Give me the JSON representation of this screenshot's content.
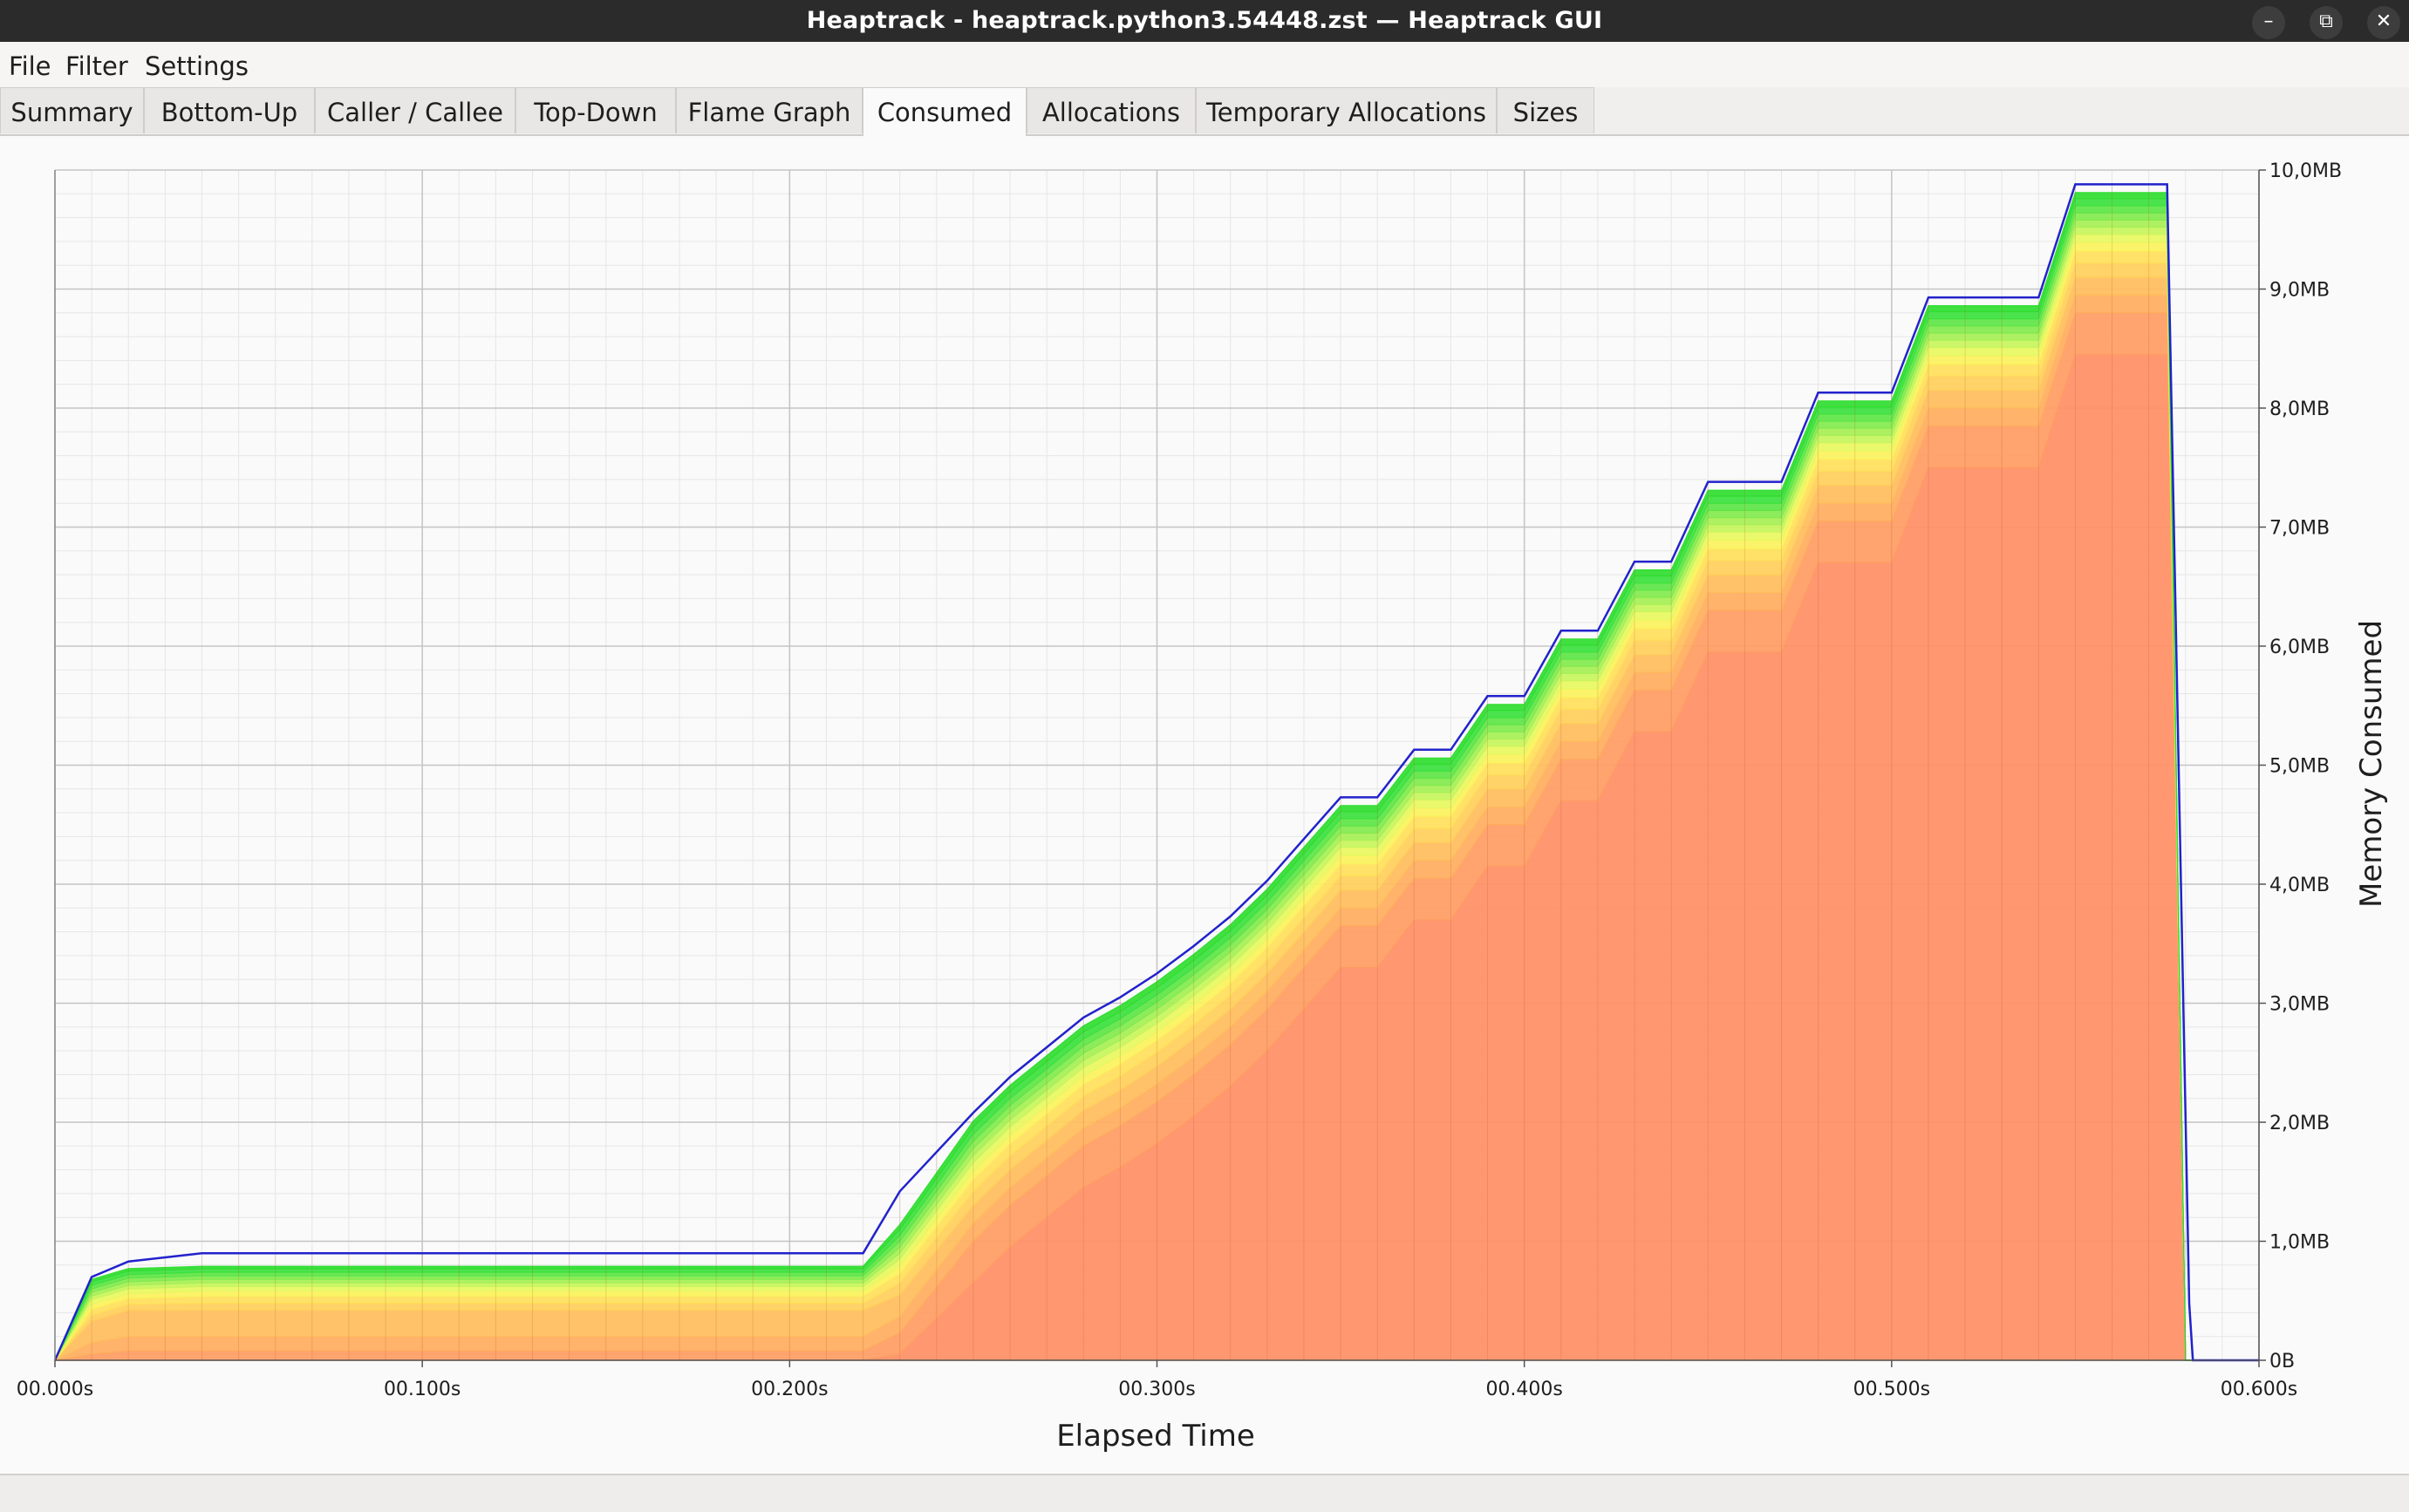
{
  "window": {
    "title": "Heaptrack - heaptrack.python3.54448.zst — Heaptrack GUI",
    "minimize_icon": "minimize-icon",
    "maximize_icon": "restore-icon",
    "close_icon": "close-icon"
  },
  "menubar": {
    "items": [
      {
        "label": "File"
      },
      {
        "label": "Filter"
      },
      {
        "label": "Settings"
      }
    ]
  },
  "tabs": [
    {
      "label": "Summary"
    },
    {
      "label": "Bottom-Up"
    },
    {
      "label": "Caller / Callee"
    },
    {
      "label": "Top-Down"
    },
    {
      "label": "Flame Graph"
    },
    {
      "label": "Consumed",
      "active": true
    },
    {
      "label": "Allocations"
    },
    {
      "label": "Temporary Allocations"
    },
    {
      "label": "Sizes"
    }
  ],
  "colors": {
    "line": "#2222cc",
    "bottom_layer": "#ff8f64",
    "top_layer": "#30dd30"
  },
  "chart_data": {
    "type": "area",
    "stacked": true,
    "xlabel": "Elapsed Time",
    "ylabel": "Memory Consumed",
    "xlim": [
      0,
      0.6
    ],
    "ylim": [
      0,
      10
    ],
    "x_ticks": [
      "00.000s",
      "00.100s",
      "00.200s",
      "00.300s",
      "00.400s",
      "00.500s",
      "00.600s"
    ],
    "y_ticks": [
      "0B",
      "1,0MB",
      "2,0MB",
      "3,0MB",
      "4,0MB",
      "5,0MB",
      "6,0MB",
      "7,0MB",
      "8,0MB",
      "9,0MB",
      "10,0MB"
    ],
    "grid": true,
    "y_axis_side": "right",
    "layer_colors": [
      "#ff8f64",
      "#ff9c62",
      "#ffac5e",
      "#ffbd5c",
      "#ffcf5a",
      "#ffe05a",
      "#fbf25c",
      "#e8f760",
      "#c8f55c",
      "#a6f056",
      "#82ea4e",
      "#5ee546",
      "#3ce13e",
      "#30dd30"
    ],
    "x": [
      0.0,
      0.01,
      0.02,
      0.04,
      0.1,
      0.2,
      0.22,
      0.23,
      0.25,
      0.26,
      0.27,
      0.28,
      0.29,
      0.3,
      0.31,
      0.32,
      0.33,
      0.34,
      0.35,
      0.36,
      0.37,
      0.38,
      0.39,
      0.4,
      0.41,
      0.42,
      0.43,
      0.44,
      0.45,
      0.46,
      0.47,
      0.48,
      0.49,
      0.5,
      0.51,
      0.52,
      0.53,
      0.54,
      0.55,
      0.56,
      0.575,
      0.58,
      0.582
    ],
    "series": [
      {
        "values": [
          0.0,
          0.0,
          0.0,
          0.0,
          0.0,
          0.0,
          0.0,
          0.05,
          0.65,
          0.95,
          1.2,
          1.45,
          1.62,
          1.82,
          2.05,
          2.3,
          2.6,
          2.95,
          3.3,
          3.3,
          3.7,
          3.7,
          4.15,
          4.15,
          4.7,
          4.7,
          5.28,
          5.28,
          5.95,
          5.95,
          5.95,
          6.7,
          6.7,
          6.7,
          7.5,
          7.5,
          7.5,
          7.5,
          8.45,
          8.45,
          8.45,
          0.0,
          0.0
        ]
      },
      {
        "values": [
          0.0,
          0.05,
          0.08,
          0.08,
          0.08,
          0.08,
          0.08,
          0.18,
          0.35,
          0.35,
          0.35,
          0.35,
          0.35,
          0.35,
          0.35,
          0.35,
          0.35,
          0.35,
          0.35,
          0.35,
          0.35,
          0.35,
          0.35,
          0.35,
          0.35,
          0.35,
          0.35,
          0.35,
          0.35,
          0.35,
          0.35,
          0.35,
          0.35,
          0.35,
          0.35,
          0.35,
          0.35,
          0.35,
          0.35,
          0.35,
          0.35,
          0.0,
          0.0
        ]
      },
      {
        "values": [
          0.0,
          0.1,
          0.12,
          0.12,
          0.12,
          0.12,
          0.12,
          0.14,
          0.15,
          0.15,
          0.15,
          0.15,
          0.15,
          0.15,
          0.15,
          0.15,
          0.15,
          0.15,
          0.15,
          0.15,
          0.15,
          0.15,
          0.15,
          0.15,
          0.15,
          0.15,
          0.15,
          0.15,
          0.15,
          0.15,
          0.15,
          0.15,
          0.15,
          0.15,
          0.15,
          0.15,
          0.15,
          0.15,
          0.15,
          0.15,
          0.15,
          0.0,
          0.0
        ]
      },
      {
        "values": [
          0.0,
          0.18,
          0.22,
          0.22,
          0.22,
          0.22,
          0.22,
          0.18,
          0.15,
          0.15,
          0.15,
          0.15,
          0.15,
          0.15,
          0.15,
          0.15,
          0.15,
          0.15,
          0.15,
          0.15,
          0.15,
          0.15,
          0.15,
          0.15,
          0.15,
          0.15,
          0.15,
          0.15,
          0.15,
          0.15,
          0.15,
          0.15,
          0.15,
          0.15,
          0.15,
          0.15,
          0.15,
          0.15,
          0.15,
          0.15,
          0.15,
          0.0,
          0.0
        ]
      },
      {
        "values": [
          0.0,
          0.05,
          0.05,
          0.06,
          0.06,
          0.06,
          0.06,
          0.1,
          0.12,
          0.12,
          0.12,
          0.12,
          0.12,
          0.12,
          0.12,
          0.12,
          0.12,
          0.12,
          0.12,
          0.12,
          0.12,
          0.12,
          0.12,
          0.12,
          0.12,
          0.12,
          0.12,
          0.12,
          0.12,
          0.12,
          0.12,
          0.12,
          0.12,
          0.12,
          0.12,
          0.12,
          0.12,
          0.12,
          0.12,
          0.12,
          0.12,
          0.0,
          0.0
        ]
      },
      {
        "values": [
          0.0,
          0.05,
          0.05,
          0.06,
          0.06,
          0.06,
          0.06,
          0.08,
          0.1,
          0.1,
          0.1,
          0.1,
          0.1,
          0.1,
          0.1,
          0.1,
          0.1,
          0.1,
          0.1,
          0.1,
          0.1,
          0.1,
          0.1,
          0.1,
          0.1,
          0.1,
          0.1,
          0.1,
          0.1,
          0.1,
          0.1,
          0.1,
          0.1,
          0.1,
          0.1,
          0.1,
          0.1,
          0.1,
          0.1,
          0.1,
          0.1,
          0.0,
          0.0
        ]
      },
      {
        "values": [
          0.0,
          0.04,
          0.04,
          0.04,
          0.04,
          0.04,
          0.04,
          0.06,
          0.07,
          0.07,
          0.07,
          0.07,
          0.07,
          0.07,
          0.07,
          0.07,
          0.07,
          0.07,
          0.07,
          0.07,
          0.07,
          0.07,
          0.07,
          0.07,
          0.07,
          0.07,
          0.07,
          0.07,
          0.07,
          0.07,
          0.07,
          0.07,
          0.07,
          0.07,
          0.07,
          0.07,
          0.07,
          0.07,
          0.07,
          0.07,
          0.07,
          0.0,
          0.0
        ]
      },
      {
        "values": [
          0.0,
          0.04,
          0.04,
          0.04,
          0.04,
          0.04,
          0.04,
          0.06,
          0.07,
          0.07,
          0.07,
          0.07,
          0.07,
          0.07,
          0.07,
          0.07,
          0.07,
          0.07,
          0.07,
          0.07,
          0.07,
          0.07,
          0.07,
          0.07,
          0.07,
          0.07,
          0.07,
          0.07,
          0.07,
          0.07,
          0.07,
          0.07,
          0.07,
          0.07,
          0.07,
          0.07,
          0.07,
          0.07,
          0.07,
          0.07,
          0.07,
          0.0,
          0.0
        ]
      },
      {
        "values": [
          0.0,
          0.03,
          0.03,
          0.03,
          0.03,
          0.03,
          0.03,
          0.05,
          0.06,
          0.06,
          0.06,
          0.06,
          0.06,
          0.06,
          0.06,
          0.06,
          0.06,
          0.06,
          0.06,
          0.06,
          0.06,
          0.06,
          0.06,
          0.06,
          0.06,
          0.06,
          0.06,
          0.06,
          0.06,
          0.06,
          0.06,
          0.06,
          0.06,
          0.06,
          0.06,
          0.06,
          0.06,
          0.06,
          0.06,
          0.06,
          0.06,
          0.0,
          0.0
        ]
      },
      {
        "values": [
          0.0,
          0.03,
          0.03,
          0.03,
          0.03,
          0.03,
          0.03,
          0.05,
          0.06,
          0.06,
          0.06,
          0.06,
          0.06,
          0.06,
          0.06,
          0.06,
          0.06,
          0.06,
          0.06,
          0.06,
          0.06,
          0.06,
          0.06,
          0.06,
          0.06,
          0.06,
          0.06,
          0.06,
          0.06,
          0.06,
          0.06,
          0.06,
          0.06,
          0.06,
          0.06,
          0.06,
          0.06,
          0.06,
          0.06,
          0.06,
          0.06,
          0.0,
          0.0
        ]
      },
      {
        "values": [
          0.0,
          0.03,
          0.03,
          0.03,
          0.03,
          0.03,
          0.03,
          0.05,
          0.06,
          0.06,
          0.06,
          0.06,
          0.06,
          0.06,
          0.06,
          0.06,
          0.06,
          0.06,
          0.06,
          0.06,
          0.06,
          0.06,
          0.06,
          0.06,
          0.06,
          0.06,
          0.06,
          0.06,
          0.06,
          0.06,
          0.06,
          0.06,
          0.06,
          0.06,
          0.06,
          0.06,
          0.06,
          0.06,
          0.06,
          0.06,
          0.06,
          0.0,
          0.0
        ]
      },
      {
        "values": [
          0.0,
          0.03,
          0.03,
          0.03,
          0.03,
          0.03,
          0.03,
          0.05,
          0.06,
          0.06,
          0.06,
          0.06,
          0.06,
          0.06,
          0.06,
          0.06,
          0.06,
          0.06,
          0.06,
          0.06,
          0.06,
          0.06,
          0.06,
          0.06,
          0.06,
          0.06,
          0.06,
          0.06,
          0.06,
          0.06,
          0.06,
          0.06,
          0.06,
          0.06,
          0.06,
          0.06,
          0.06,
          0.06,
          0.06,
          0.06,
          0.06,
          0.0,
          0.0
        ]
      },
      {
        "values": [
          0.0,
          0.03,
          0.03,
          0.03,
          0.03,
          0.03,
          0.03,
          0.05,
          0.06,
          0.06,
          0.06,
          0.06,
          0.06,
          0.06,
          0.06,
          0.06,
          0.06,
          0.06,
          0.06,
          0.06,
          0.06,
          0.06,
          0.06,
          0.06,
          0.06,
          0.06,
          0.06,
          0.06,
          0.06,
          0.06,
          0.06,
          0.06,
          0.06,
          0.06,
          0.06,
          0.06,
          0.06,
          0.06,
          0.06,
          0.06,
          0.06,
          0.0,
          0.0
        ]
      },
      {
        "values": [
          0.0,
          0.02,
          0.02,
          0.02,
          0.02,
          0.02,
          0.02,
          0.04,
          0.05,
          0.05,
          0.05,
          0.05,
          0.05,
          0.05,
          0.05,
          0.05,
          0.05,
          0.05,
          0.05,
          0.05,
          0.05,
          0.05,
          0.05,
          0.05,
          0.05,
          0.05,
          0.05,
          0.05,
          0.05,
          0.05,
          0.05,
          0.05,
          0.05,
          0.05,
          0.05,
          0.05,
          0.05,
          0.05,
          0.05,
          0.05,
          0.05,
          0.0,
          0.0
        ]
      }
    ],
    "total": {
      "x": [
        0.0,
        0.01,
        0.02,
        0.04,
        0.1,
        0.2,
        0.22,
        0.23,
        0.25,
        0.26,
        0.27,
        0.28,
        0.29,
        0.3,
        0.31,
        0.32,
        0.33,
        0.34,
        0.35,
        0.36,
        0.37,
        0.38,
        0.39,
        0.4,
        0.41,
        0.42,
        0.43,
        0.44,
        0.45,
        0.46,
        0.47,
        0.48,
        0.49,
        0.5,
        0.51,
        0.52,
        0.53,
        0.54,
        0.55,
        0.56,
        0.575,
        0.581,
        0.582,
        0.6
      ],
      "values": [
        0.0,
        0.7,
        0.83,
        0.9,
        0.9,
        0.9,
        0.9,
        1.42,
        2.08,
        2.38,
        2.63,
        2.88,
        3.05,
        3.25,
        3.48,
        3.73,
        4.03,
        4.38,
        4.73,
        4.73,
        5.13,
        5.13,
        5.58,
        5.58,
        6.13,
        6.13,
        6.71,
        6.71,
        7.38,
        7.38,
        7.38,
        8.13,
        8.13,
        8.13,
        8.93,
        8.93,
        8.93,
        8.93,
        9.88,
        9.88,
        9.88,
        0.48,
        0.0,
        0.0
      ]
    }
  }
}
